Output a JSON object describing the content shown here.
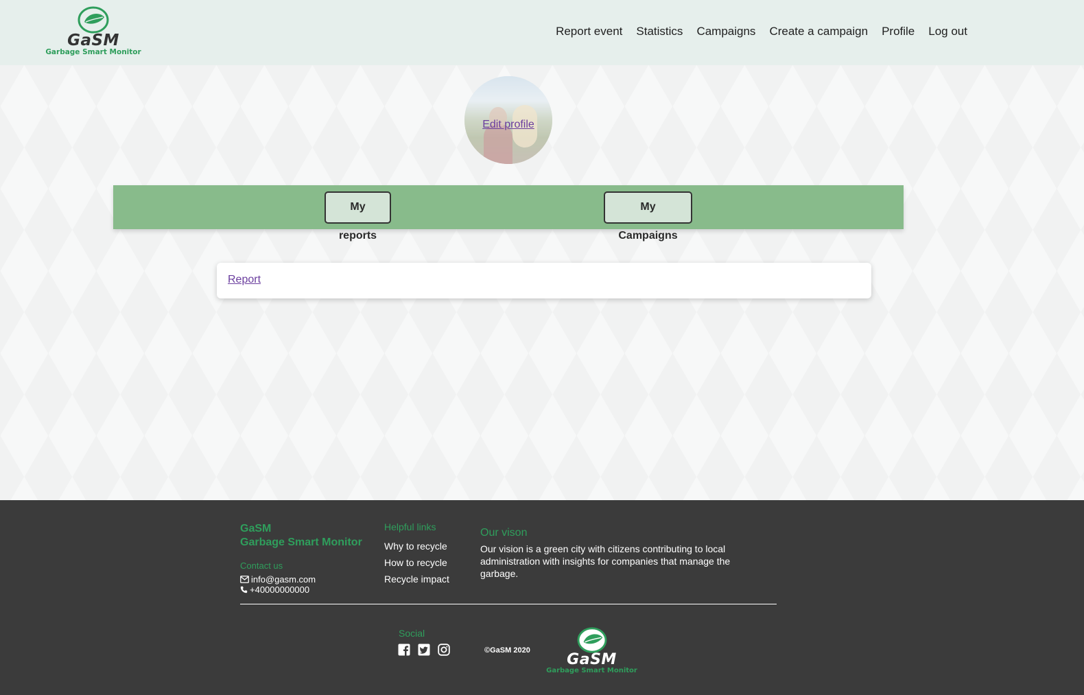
{
  "header": {
    "logo": {
      "word": "GaSM",
      "tagline": "Garbage Smart Monitor"
    },
    "nav": [
      "Report event",
      "Statistics",
      "Campaigns",
      "Create a campaign",
      "Profile",
      "Log out"
    ]
  },
  "profile": {
    "edit_link": "Edit profile",
    "tabs": {
      "reports": "My reports",
      "campaigns": "My Campaigns"
    },
    "report_link": "Report"
  },
  "footer": {
    "brand_line1": "GaSM",
    "brand_line2": "Garbage Smart Monitor",
    "contact_heading": "Contact us",
    "email": "info@gasm.com",
    "phone": "+40000000000",
    "links_heading": "Helpful links",
    "links": [
      "Why to recycle",
      "How to recycle",
      "Recycle impact"
    ],
    "vision_heading": "Our vison",
    "vision_text": "Our vision is a green city with citizens contributing to local administration with insights for companies that manage the garbage.",
    "social_heading": "Social",
    "social_icons": [
      "facebook-icon",
      "twitter-icon",
      "instagram-icon"
    ],
    "copyright": "©GaSM 2020",
    "logo": {
      "word": "GaSM",
      "tagline": "Garbage Smart Monitor"
    }
  },
  "colors": {
    "brand_green": "#2f9e5c",
    "tabbar_green": "#88bb8b",
    "header_bg": "#e6efec",
    "footer_bg": "#3b3b3b",
    "link_purple": "#6a3d9e"
  }
}
